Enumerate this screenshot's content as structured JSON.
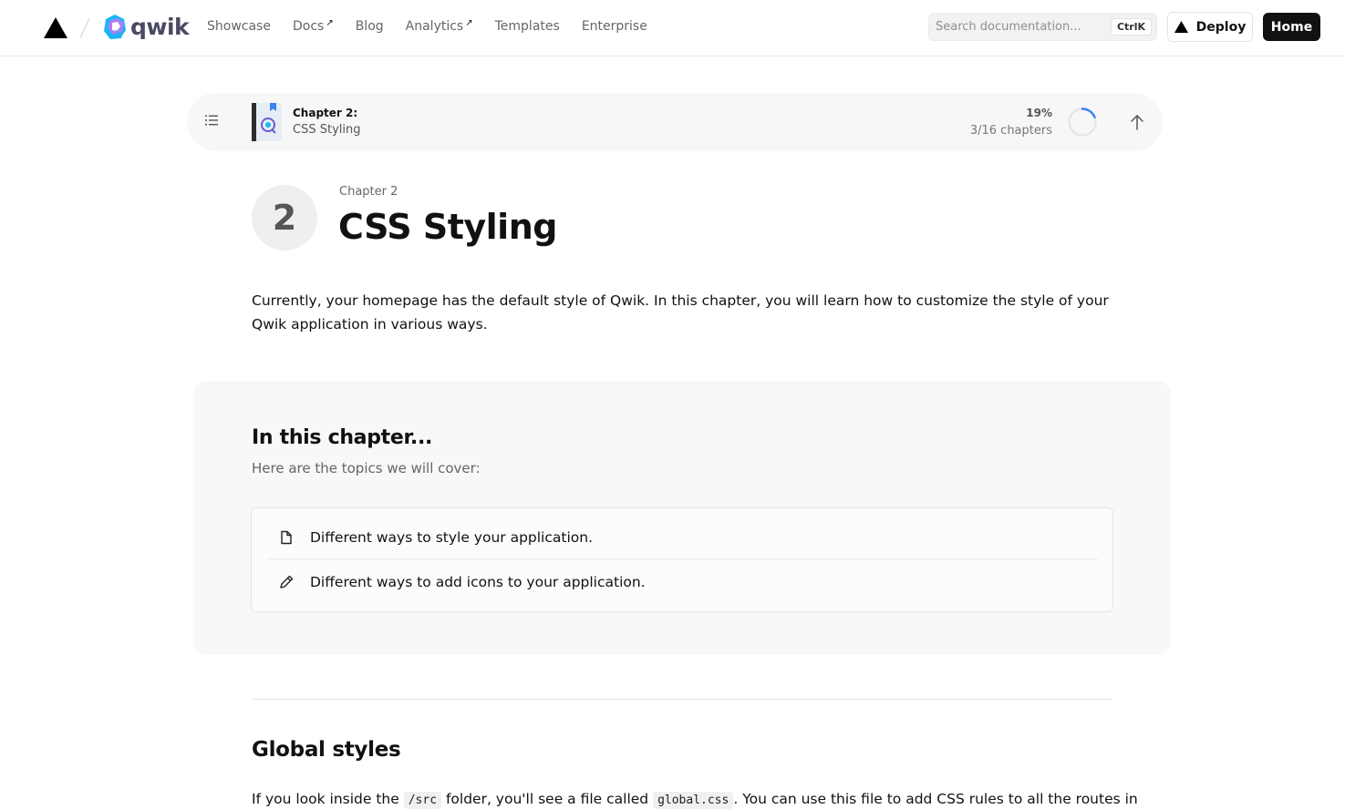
{
  "nav": {
    "brand": "qwik",
    "links": [
      {
        "label": "Showcase",
        "external": false
      },
      {
        "label": "Docs",
        "external": true
      },
      {
        "label": "Blog",
        "external": false
      },
      {
        "label": "Analytics",
        "external": true
      },
      {
        "label": "Templates",
        "external": false
      },
      {
        "label": "Enterprise",
        "external": false
      }
    ],
    "external_glyph": "↗",
    "search_placeholder": "Search documentation...",
    "search_shortcut": "CtrlK",
    "deploy_label": "Deploy",
    "home_label": "Home"
  },
  "progress": {
    "chapter_label": "Chapter 2:",
    "chapter_name": "CSS Styling",
    "percent_label": "19%",
    "percent_value": 19,
    "chapters_count": "3/16 chapters"
  },
  "header": {
    "number": "2",
    "eyebrow": "Chapter 2",
    "title": "CSS Styling"
  },
  "intro": "Currently, your homepage has the default style of Qwik. In this chapter, you will learn how to customize the style of your Qwik application in various ways.",
  "chapter_box": {
    "title": "In this chapter...",
    "subtitle": "Here are the topics we will cover:",
    "topics": [
      {
        "icon": "document-icon",
        "label": "Different ways to style your application."
      },
      {
        "icon": "pencil-icon",
        "label": "Different ways to add icons to your application."
      }
    ]
  },
  "section": {
    "heading": "Global styles",
    "para_part1": "If you look inside the ",
    "code1": "/src",
    "para_part2": " folder, you'll see a file called ",
    "code2": "global.css",
    "para_part3": ". You can use this file to add CSS rules to all the routes in"
  },
  "colors": {
    "accent_blue": "#3b82f6",
    "qwik_blue": "#18b6f6",
    "qwik_purple": "#ac7ef4",
    "dark": "#111111"
  }
}
